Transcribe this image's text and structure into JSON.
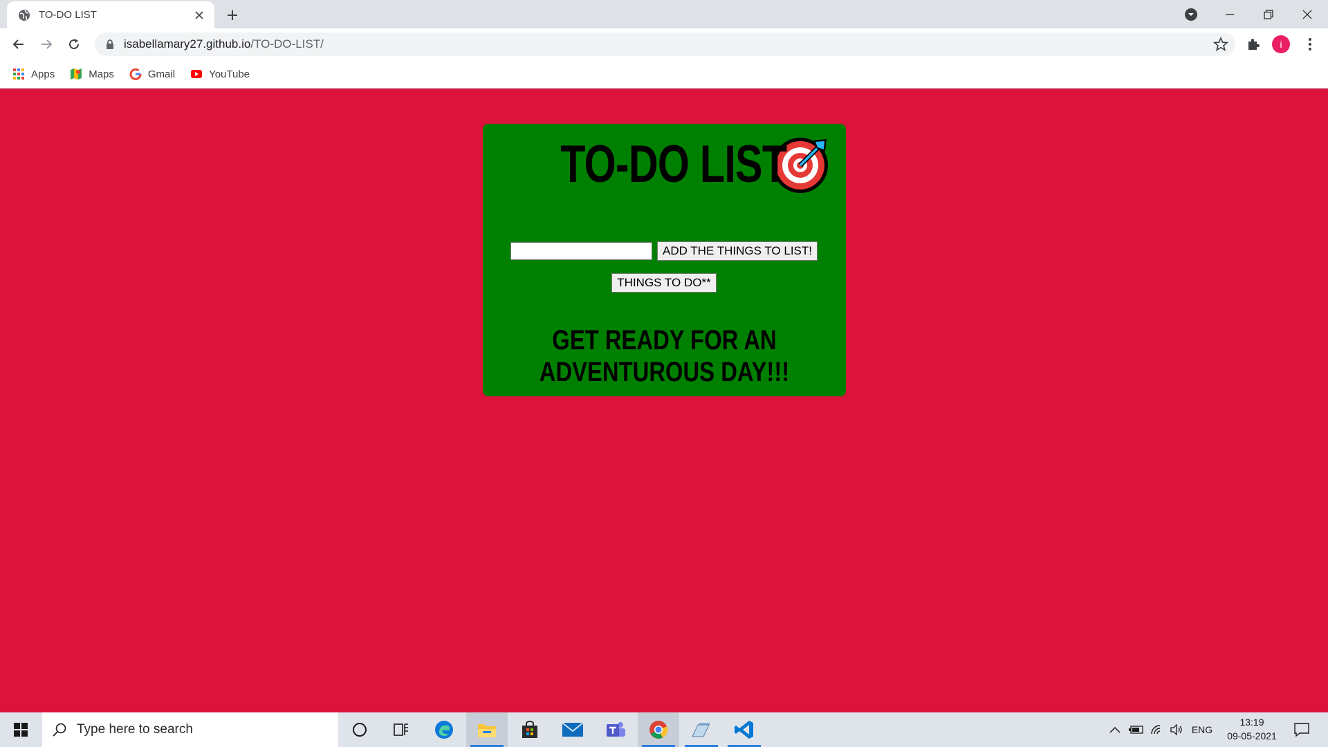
{
  "browser": {
    "tab_title": "TO-DO LIST",
    "url_host": "isabellamary27.github.io",
    "url_path": "/TO-DO-LIST/",
    "profile_initial": "i",
    "bookmarks": [
      {
        "label": "Apps",
        "icon": "apps-grid-icon"
      },
      {
        "label": "Maps",
        "icon": "maps-icon"
      },
      {
        "label": "Gmail",
        "icon": "google-g-icon"
      },
      {
        "label": "YouTube",
        "icon": "youtube-icon"
      }
    ]
  },
  "page": {
    "background_color": "#dc143c",
    "card_color": "#008000",
    "title": "TO-DO LIST",
    "title_icon": "target-dart-icon",
    "input_value": "",
    "add_button_label": "ADD THE THINGS TO LIST!",
    "things_button_label": "THINGS TO DO**",
    "tagline": "GET READY FOR AN ADVENTUROUS DAY!!!"
  },
  "taskbar": {
    "search_placeholder": "Type here to search",
    "apps": [
      "cortana-icon",
      "task-view-icon",
      "edge-icon",
      "file-explorer-icon",
      "store-icon",
      "mail-icon",
      "teams-icon",
      "chrome-icon",
      "photos-icon",
      "vscode-icon"
    ],
    "language": "ENG",
    "time": "13:19",
    "date": "09-05-2021"
  }
}
